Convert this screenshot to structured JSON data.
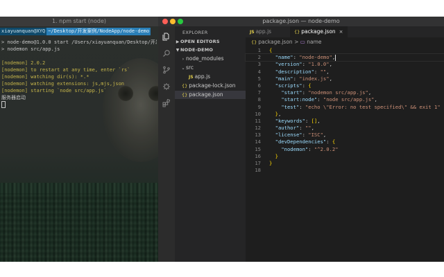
{
  "terminal": {
    "title": "1. npm start (node)",
    "prompt_user": "xiayuanquan@XYQ",
    "prompt_path": "~/Desktop/开发案例/NodeApp/node-demo",
    "lines": [
      {
        "text": "> node-demo@1.0.0 start /Users/xiayuanquan/Desktop/开发",
        "yellow": false
      },
      {
        "text": "> nodemon src/app.js",
        "yellow": false
      },
      {
        "text": "",
        "yellow": false
      },
      {
        "text": "[nodemon] 2.0.2",
        "yellow": true
      },
      {
        "text": "[nodemon] to restart at any time, enter `rs`",
        "yellow": true
      },
      {
        "text": "[nodemon] watching dir(s): *.*",
        "yellow": true
      },
      {
        "text": "[nodemon] watching extensions: js,mjs,json",
        "yellow": true
      },
      {
        "text": "[nodemon] starting `node src/app.js`",
        "yellow": true
      },
      {
        "text": "服务器启动",
        "yellow": false
      }
    ]
  },
  "vscode": {
    "window_title": "package.json — node-demo",
    "sidebar": {
      "header": "EXPLORER",
      "open_editors": "OPEN EDITORS",
      "project": "NODE-DEMO",
      "items": [
        {
          "label": "node_modules",
          "kind": "folder"
        },
        {
          "label": "src",
          "kind": "folder-open"
        },
        {
          "label": "app.js",
          "kind": "js"
        },
        {
          "label": "package-lock.json",
          "kind": "json"
        },
        {
          "label": "package.json",
          "kind": "json"
        }
      ]
    },
    "tabs": [
      {
        "label": "app.js",
        "badge": "JS"
      },
      {
        "label": "package.json",
        "badge": "{}"
      }
    ],
    "breadcrumb": {
      "file": "package.json",
      "sep": ">",
      "symbol": "name"
    },
    "code_lines": [
      "{",
      "  \"name\": \"node-demo\",",
      "  \"version\": \"1.0.0\",",
      "  \"description\": \"\",",
      "  \"main\": \"index.js\",",
      "  \"scripts\": {",
      "    \"start\": \"nodemon src/app.js\",",
      "    \"start:node\": \"node src/app.js\",",
      "    \"test\": \"echo \\\"Error: no test specified\\\" && exit 1\"",
      "  },",
      "  \"keywords\": [],",
      "  \"author\": \"\",",
      "  \"license\": \"ISC\",",
      "  \"devDependencies\": {",
      "    \"nodemon\": \"^2.0.2\"",
      "  }",
      "}",
      ""
    ]
  },
  "colors": {
    "editor_bg": "#1e1e1e",
    "sidebar_bg": "#252526",
    "activity_bg": "#2c2c2c",
    "key": "#9cdcfe",
    "string": "#ce9178",
    "json_icon": "#e8d44d",
    "prompt_blue": "#2a7fb8"
  },
  "icons": {
    "explorer": "files-icon",
    "search": "search-icon",
    "scm": "source-control-icon",
    "debug": "debug-icon",
    "extensions": "extensions-icon"
  }
}
